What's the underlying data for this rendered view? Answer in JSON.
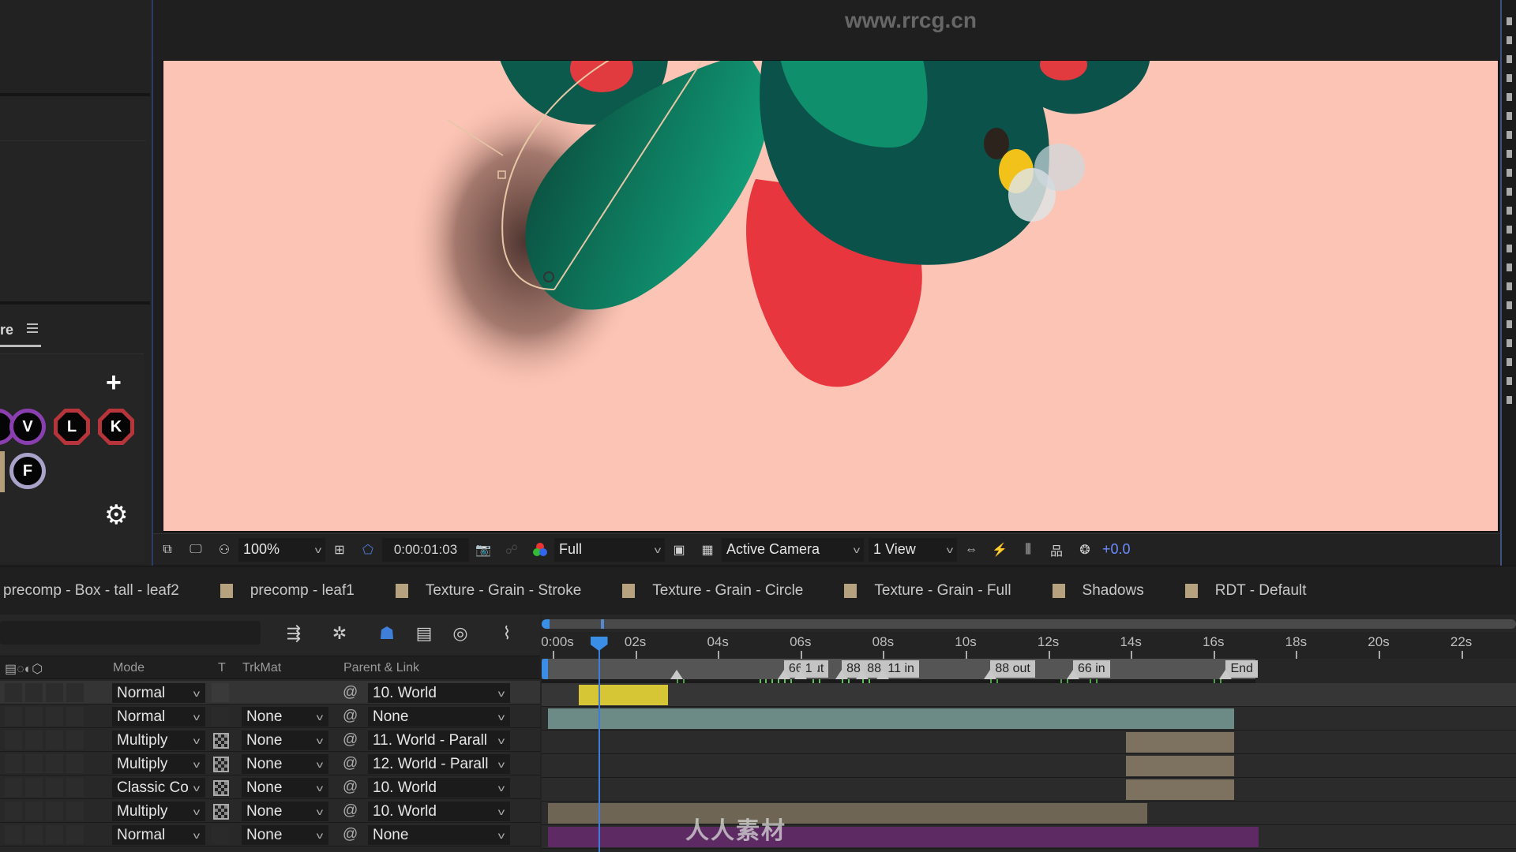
{
  "left_panel": {
    "panel_tab_label": "re",
    "add_label": "+",
    "hotkeys": [
      {
        "key": "V",
        "ring_color": "#8a3fb0",
        "shape": "circle"
      },
      {
        "key": "L",
        "ring_color": "#b7343a",
        "shape": "octagon"
      },
      {
        "key": "K",
        "ring_color": "#b7343a",
        "shape": "octagon"
      },
      {
        "key": "F",
        "ring_color": "#a9a2c9",
        "shape": "circle"
      }
    ],
    "settings_icon": "gear-icon"
  },
  "viewer": {
    "watermark": "www.rrcg.cn",
    "toolbar": {
      "zoom": "100%",
      "timecode": "0:00:01:03",
      "resolution": "Full",
      "camera": "Active Camera",
      "views": "1 View",
      "exposure": "+0.0"
    },
    "colors": {
      "background": "#fcc4b4",
      "leaf_green": "#0f8f6c",
      "leaf_dark": "#0b5049",
      "petal_red": "#e8343e",
      "accent_blue": "#3a8ee6"
    }
  },
  "comp_tabs": [
    {
      "label": "precomp - Box - tall - leaf2",
      "swatch": false
    },
    {
      "label": "precomp - leaf1",
      "swatch": true
    },
    {
      "label": "Texture - Grain - Stroke",
      "swatch": true
    },
    {
      "label": "Texture - Grain - Circle",
      "swatch": true
    },
    {
      "label": "Texture - Grain - Full",
      "swatch": true
    },
    {
      "label": "Shadows",
      "swatch": true
    },
    {
      "label": "RDT - Default",
      "swatch": true
    }
  ],
  "timeline": {
    "columns": {
      "mode": "Mode",
      "t": "T",
      "trkmat": "TrkMat",
      "parent": "Parent & Link"
    },
    "layers": [
      {
        "mode": "Normal",
        "t_toggle": false,
        "trkmat": "",
        "parent": "10. World"
      },
      {
        "mode": "Normal",
        "t_toggle": false,
        "trkmat": "None",
        "parent": "None"
      },
      {
        "mode": "Multiply",
        "t_toggle": true,
        "trkmat": "None",
        "parent": "11. World - Parall"
      },
      {
        "mode": "Multiply",
        "t_toggle": true,
        "trkmat": "None",
        "parent": "12. World - Parall"
      },
      {
        "mode": "Classic Co",
        "t_toggle": true,
        "trkmat": "None",
        "parent": "10. World"
      },
      {
        "mode": "Multiply",
        "t_toggle": true,
        "trkmat": "None",
        "parent": "10. World"
      },
      {
        "mode": "Normal",
        "t_toggle": false,
        "trkmat": "None",
        "parent": "None"
      }
    ],
    "ruler": {
      "labels": [
        "0:00s",
        "02s",
        "04s",
        "06s",
        "08s",
        "10s",
        "12s",
        "14s",
        "16s",
        "18s",
        "20s",
        "22s"
      ],
      "seconds": [
        0,
        2,
        4,
        6,
        8,
        10,
        12,
        14,
        16,
        18,
        20,
        22
      ]
    },
    "current_time_seconds": 1.1,
    "markers": [
      {
        "label": "66 out",
        "time": 5.6
      },
      {
        "label": "1",
        "time": 6.0
      },
      {
        "label": "88",
        "time": 7.0
      },
      {
        "label": "88",
        "time": 7.5
      },
      {
        "label": "11 in",
        "time": 8.0
      },
      {
        "label": "88 out",
        "time": 10.6
      },
      {
        "label": "66 in",
        "time": 12.6
      },
      {
        "label": "End",
        "time": 16.3
      }
    ],
    "keyframes_seconds": [
      3.0,
      5.0,
      5.3,
      5.6,
      6.3,
      7.0,
      7.5,
      10.6,
      12.3,
      13.0,
      16.0
    ],
    "bars": [
      {
        "start": 0.75,
        "end": 2.8,
        "color": "#d6c534"
      },
      {
        "start": 0.0,
        "end": 16.5,
        "color": "#6c8a86"
      },
      {
        "start": 14.0,
        "end": 16.5,
        "color": "#7d715f"
      },
      {
        "start": 14.0,
        "end": 16.5,
        "color": "#7d715f"
      },
      {
        "start": 14.0,
        "end": 16.5,
        "color": "#7d715f"
      },
      {
        "start": 0.0,
        "end": 14.4,
        "color": "#6e6554"
      },
      {
        "start": 0.0,
        "end": 17.1,
        "color": "#5d2a63"
      }
    ]
  },
  "watermark_logo": "人人素材"
}
